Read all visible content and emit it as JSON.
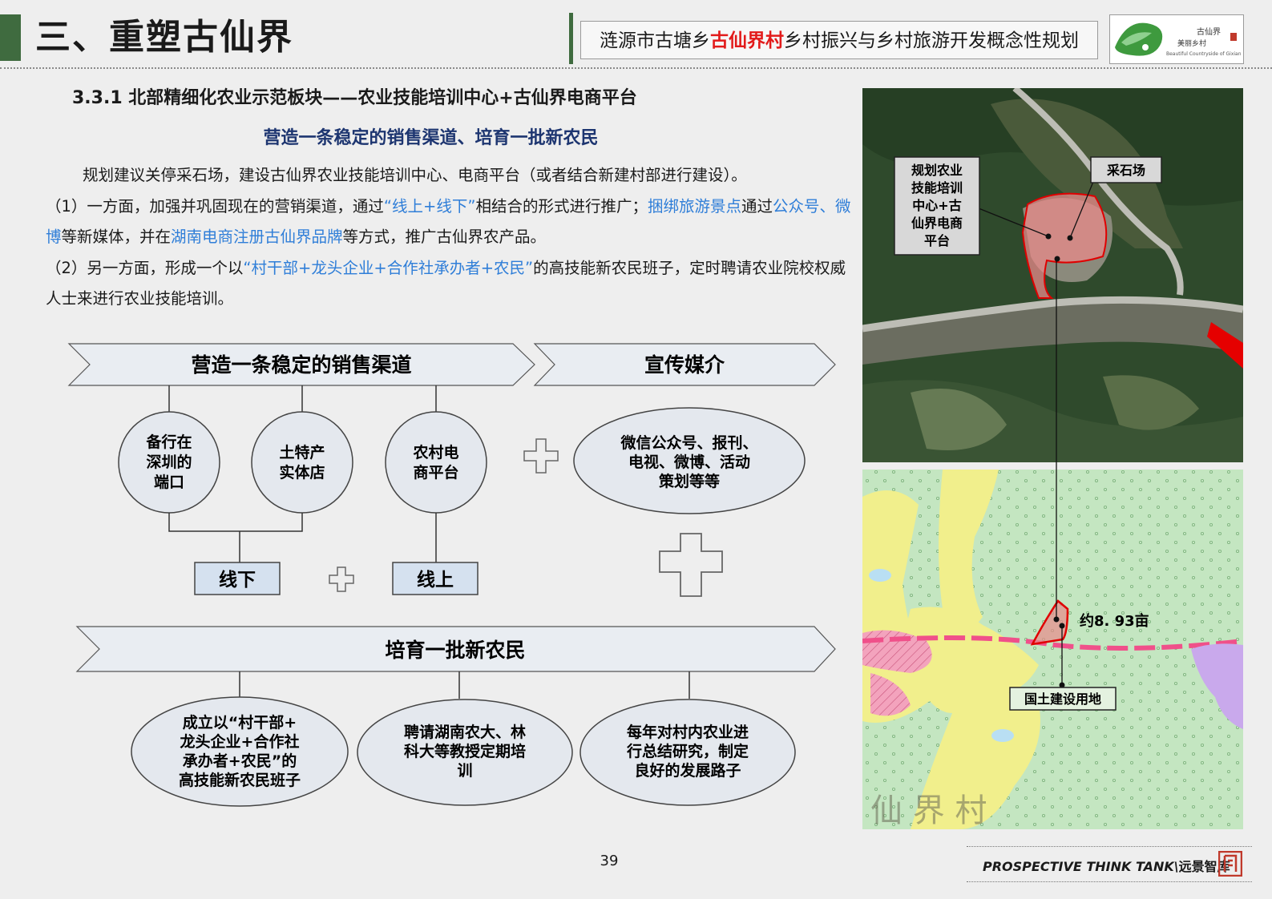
{
  "header": {
    "section_title": "三、重塑古仙界",
    "plan_prefix": "涟源市古塘乡",
    "plan_highlight": "古仙界村",
    "plan_suffix": "乡村振兴与乡村旅游开发概念性规划",
    "logo_text": [
      "古仙界",
      "美丽乡村",
      "Beautiful Countryside of Gixian"
    ]
  },
  "subheading": "3.3.1  北部精细化农业示范板块——农业技能培训中心+古仙界电商平台",
  "slogan": "营造一条稳定的销售渠道、培育一批新农民",
  "body": {
    "p1": "规划建议关停采石场，建设古仙界农业技能培训中心、电商平台（或者结合新建村部进行建设）。",
    "p2": {
      "a": "（1）一方面，加强并巩固现在的营销渠道，通过",
      "b": "“线上+线下”",
      "c": "相结合的形式进行推广；",
      "d": "捆绑旅游景点",
      "e": "通过",
      "f": "公众号、微博",
      "g": "等新媒体，并在",
      "h": "湖南电商注册古仙界品牌",
      "i": "等方式，推广古仙界农产品。"
    },
    "p3": {
      "a": "（2）另一方面，形成一个以",
      "b": "“村干部+龙头企业+合作社承办者+农民”",
      "c": "的高技能新农民班子，定时聘请农业院校权威人士来进行农业技能培训。"
    }
  },
  "diagram": {
    "banner_sales": "营造一条稳定的销售渠道",
    "banner_media": "宣传媒介",
    "circle1": [
      "备行在",
      "深圳的",
      "端口"
    ],
    "circle2": [
      "土特产",
      "实体店"
    ],
    "circle3": [
      "农村电",
      "商平台"
    ],
    "media_ellipse": [
      "微信公众号、报刊、",
      "电视、微博、活动",
      "策划等等"
    ],
    "offline": "线下",
    "online": "线上",
    "banner_farmers": "培育一批新农民",
    "ellipse1": [
      "成立以“村干部+",
      "龙头企业+合作社",
      "承办者+农民”的",
      "高技能新农民班子"
    ],
    "ellipse2": [
      "聘请湖南农大、林",
      "科大等教授定期培",
      "训"
    ],
    "ellipse3": [
      "每年对村内农业进",
      "行总结研究，制定",
      "良好的发展路子"
    ]
  },
  "map": {
    "callout_center": [
      "规划农业",
      "技能培训",
      "中心+古",
      "仙界电商",
      "平台"
    ],
    "callout_quarry": "采石场",
    "area_label": "约8. 93亩",
    "land_label": "国土建设用地",
    "bottom_watermark": "仙 界 村"
  },
  "footer": {
    "page_number": "39",
    "brand_en": "PROSPECTIVE THINK TANK\\",
    "brand_cn": "远景智库"
  }
}
